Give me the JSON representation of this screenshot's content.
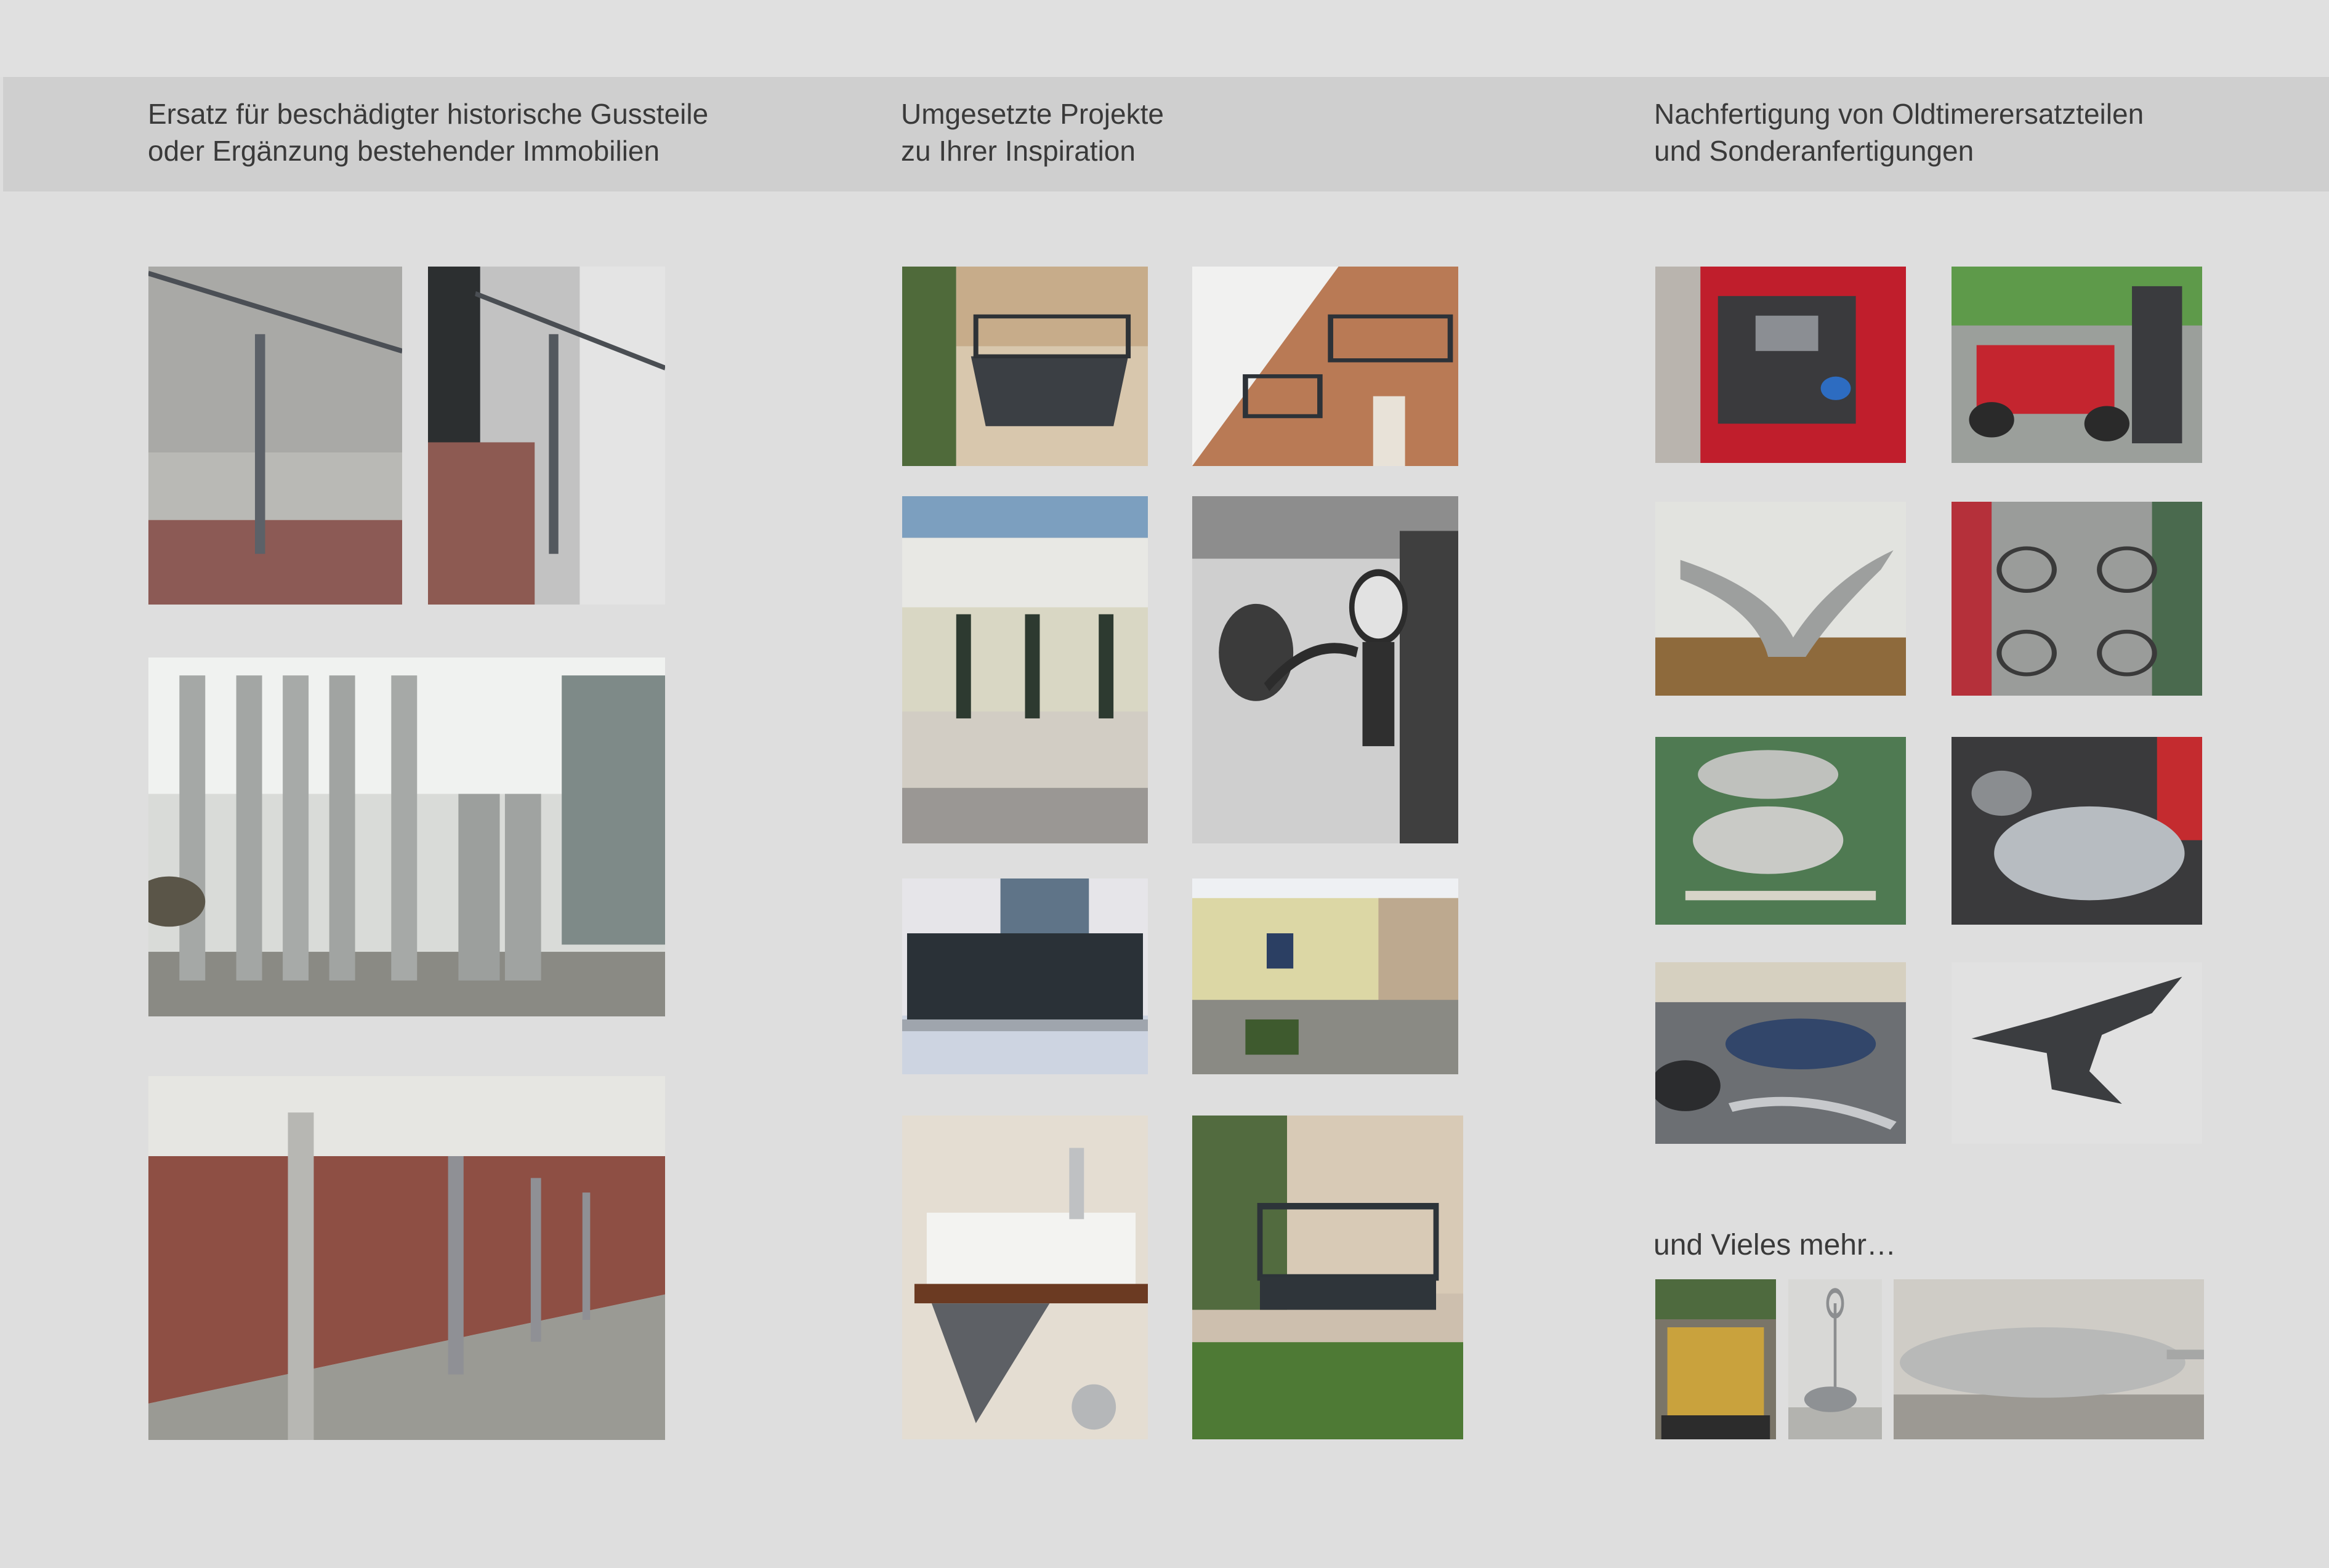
{
  "columns": [
    {
      "line1": "Ersatz für beschädigter historische Gussteile",
      "line2": "oder Ergänzung bestehender Immobilien"
    },
    {
      "line1": "Umgesetzte Projekte",
      "line2": "zu Ihrer Inspiration"
    },
    {
      "line1": "Nachfertigung von Oldtimerersatzteilen",
      "line2": "und Sonderanfertigungen"
    }
  ],
  "more_label": "und Vieles mehr…",
  "colors": {
    "page": "#dedede",
    "band": "#cfcfcf",
    "text": "#3a3a3a"
  }
}
